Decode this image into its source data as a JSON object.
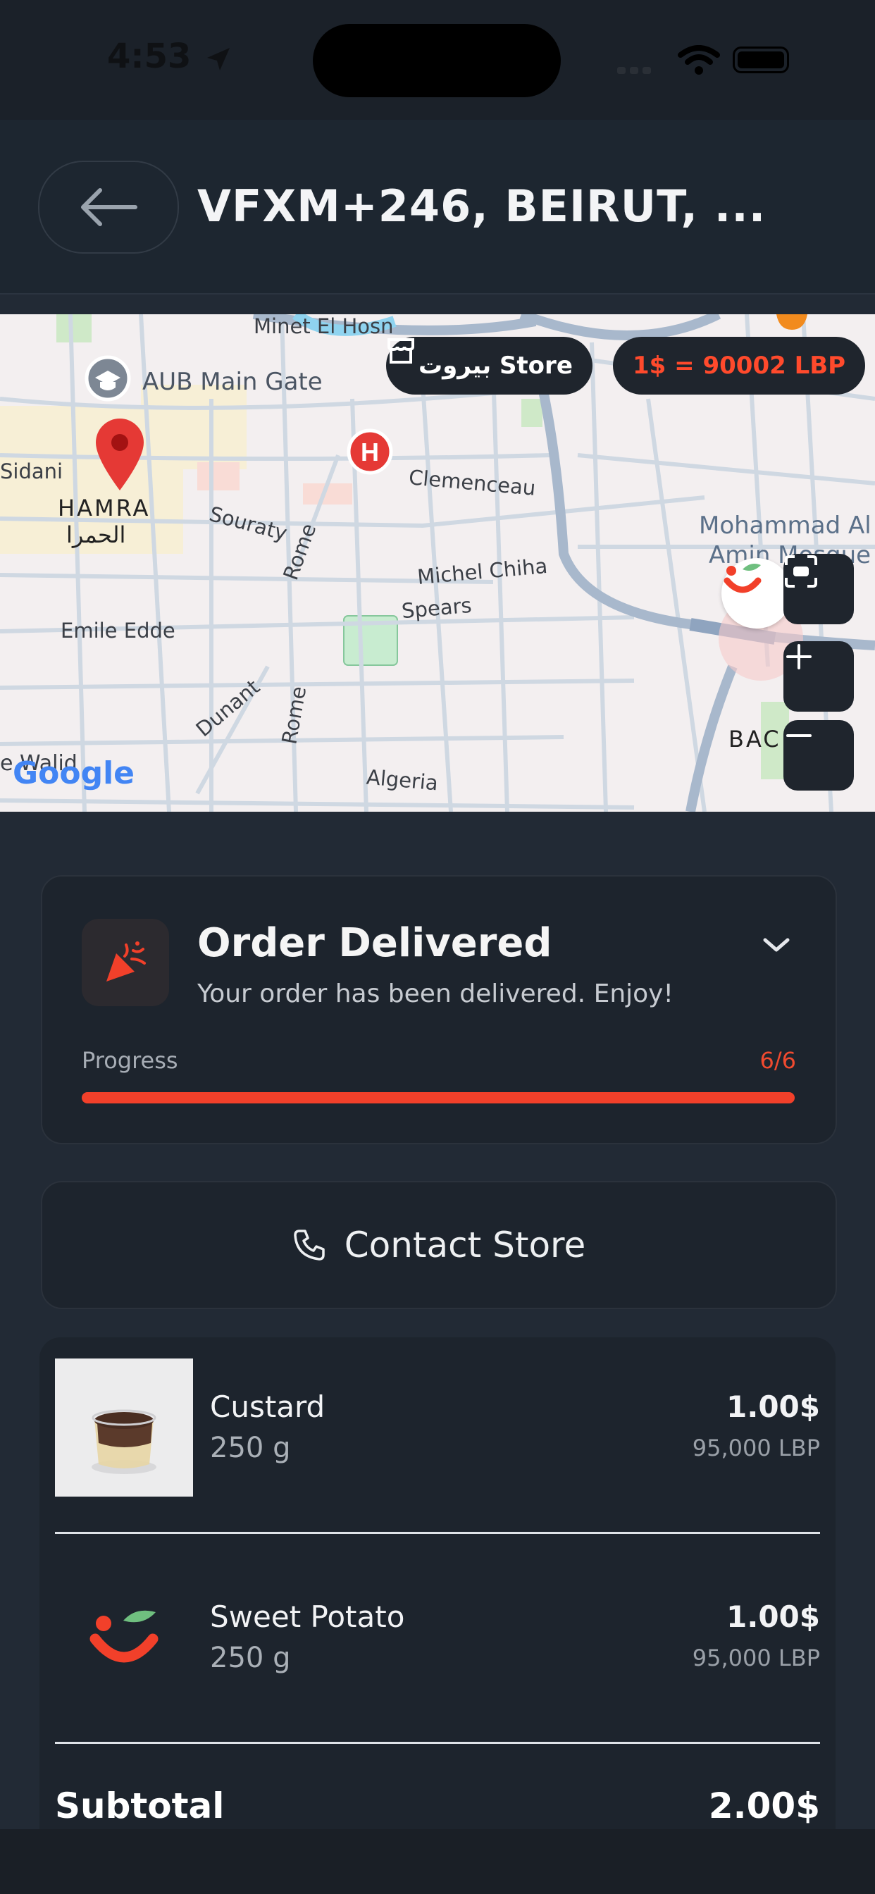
{
  "status_bar": {
    "time": "4:53"
  },
  "header": {
    "title": "VFXM+246, BEIRUT, ..."
  },
  "map": {
    "store_pill": "بيروت Store",
    "rate_pill": "1$ = 90002 LBP",
    "labels": {
      "minet": "Minet El Hosn",
      "aub": "AUB Main Gate",
      "sidani": "Sidani",
      "hamra": "HAMRA",
      "hamra_ar": "الحمرا",
      "souraty": "Souraty",
      "rome1": "Rome",
      "clemenceau": "Clemenceau",
      "michel": "Michel Chiha",
      "spears": "Spears",
      "emile": "Emile Edde",
      "dunant": "Dunant",
      "rome2": "Rome",
      "algeria": "Algeria",
      "mohammad": "Mohammad Al",
      "amin": "Amin Mosque",
      "bac": "BAC",
      "walid": "e Walid",
      "google": "Google"
    },
    "colors": {
      "pin": "#e53935",
      "hospital": "#e53935"
    }
  },
  "order": {
    "title": "Order Delivered",
    "subtitle": "Your order has been delivered. Enjoy!",
    "progress_label": "Progress",
    "progress_count": "6/6",
    "progress_fraction": 1.0
  },
  "contact": {
    "label": "Contact Store"
  },
  "items": [
    {
      "name": "Custard",
      "qty": "250 g",
      "price": "1.00$",
      "lbp": "95,000 LBP",
      "icon": "custard-photo"
    },
    {
      "name": "Sweet Potato",
      "qty": "250 g",
      "price": "1.00$",
      "lbp": "95,000 LBP",
      "icon": "store-logo-icon"
    }
  ],
  "summary": {
    "subtotal_label": "Subtotal",
    "subtotal_value": "2.00$"
  },
  "accent": "#f2402a"
}
